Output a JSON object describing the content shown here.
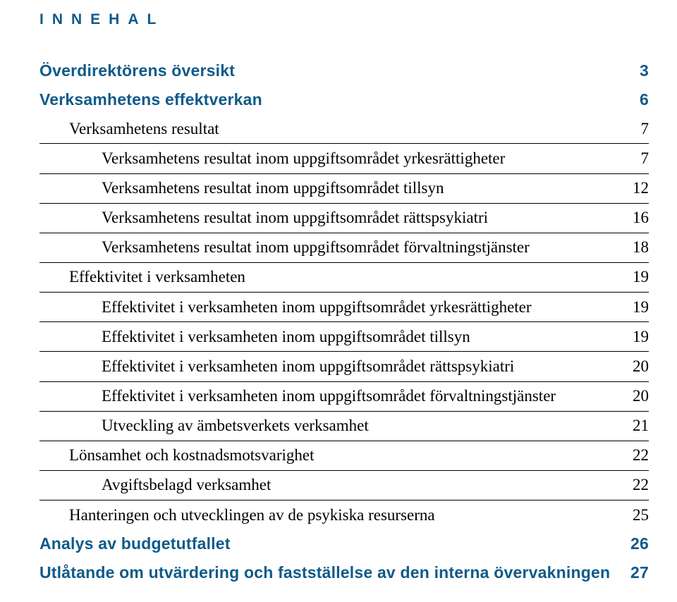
{
  "header": "INNEHAL",
  "toc": [
    {
      "label": "Överdirektörens översikt",
      "page": "3",
      "level": 0,
      "indent": 0,
      "rule": false
    },
    {
      "label": "Verksamhetens effektverkan",
      "page": "6",
      "level": 0,
      "indent": 0,
      "rule": false
    },
    {
      "label": "Verksamhetens resultat",
      "page": "7",
      "level": 1,
      "indent": 1,
      "rule": true
    },
    {
      "label": "Verksamhetens resultat inom uppgiftsområdet yrkesrättigheter",
      "page": "7",
      "level": 2,
      "indent": 2,
      "rule": true
    },
    {
      "label": "Verksamhetens resultat inom uppgiftsområdet tillsyn",
      "page": "12",
      "level": 2,
      "indent": 2,
      "rule": true
    },
    {
      "label": "Verksamhetens resultat inom uppgiftsområdet rättspsykiatri",
      "page": "16",
      "level": 2,
      "indent": 2,
      "rule": true
    },
    {
      "label": "Verksamhetens resultat inom uppgiftsområdet förvaltningstjänster",
      "page": "18",
      "level": 2,
      "indent": 2,
      "rule": true
    },
    {
      "label": "Effektivitet i verksamheten",
      "page": "19",
      "level": 1,
      "indent": 1,
      "rule": true
    },
    {
      "label": "Effektivitet i verksamheten inom uppgiftsområdet yrkesrättigheter",
      "page": "19",
      "level": 2,
      "indent": 2,
      "rule": true
    },
    {
      "label": "Effektivitet i verksamheten inom uppgiftsområdet tillsyn",
      "page": "19",
      "level": 2,
      "indent": 2,
      "rule": true
    },
    {
      "label": "Effektivitet i verksamheten inom uppgiftsområdet rättspsykiatri",
      "page": "20",
      "level": 2,
      "indent": 2,
      "rule": true
    },
    {
      "label": "Effektivitet i verksamheten inom uppgiftsområdet förvaltningstjänster",
      "page": "20",
      "level": 2,
      "indent": 2,
      "rule": true
    },
    {
      "label": "Utveckling av ämbetsverkets verksamhet",
      "page": "21",
      "level": 2,
      "indent": 2,
      "rule": true
    },
    {
      "label": "Lönsamhet och kostnadsmotsvarighet",
      "page": "22",
      "level": 1,
      "indent": 1,
      "rule": true
    },
    {
      "label": "Avgiftsbelagd verksamhet",
      "page": "22",
      "level": 2,
      "indent": 2,
      "rule": true
    },
    {
      "label": "Hanteringen och utvecklingen av de psykiska resurserna",
      "page": "25",
      "level": 1,
      "indent": 1,
      "rule": false
    },
    {
      "label": "Analys av budgetutfallet",
      "page": "26",
      "level": 0,
      "indent": 0,
      "rule": false
    },
    {
      "label": "Utlåtande om utvärdering och fastställelse av den interna övervakningen",
      "page": "27",
      "level": 0,
      "indent": 0,
      "rule": false
    }
  ]
}
